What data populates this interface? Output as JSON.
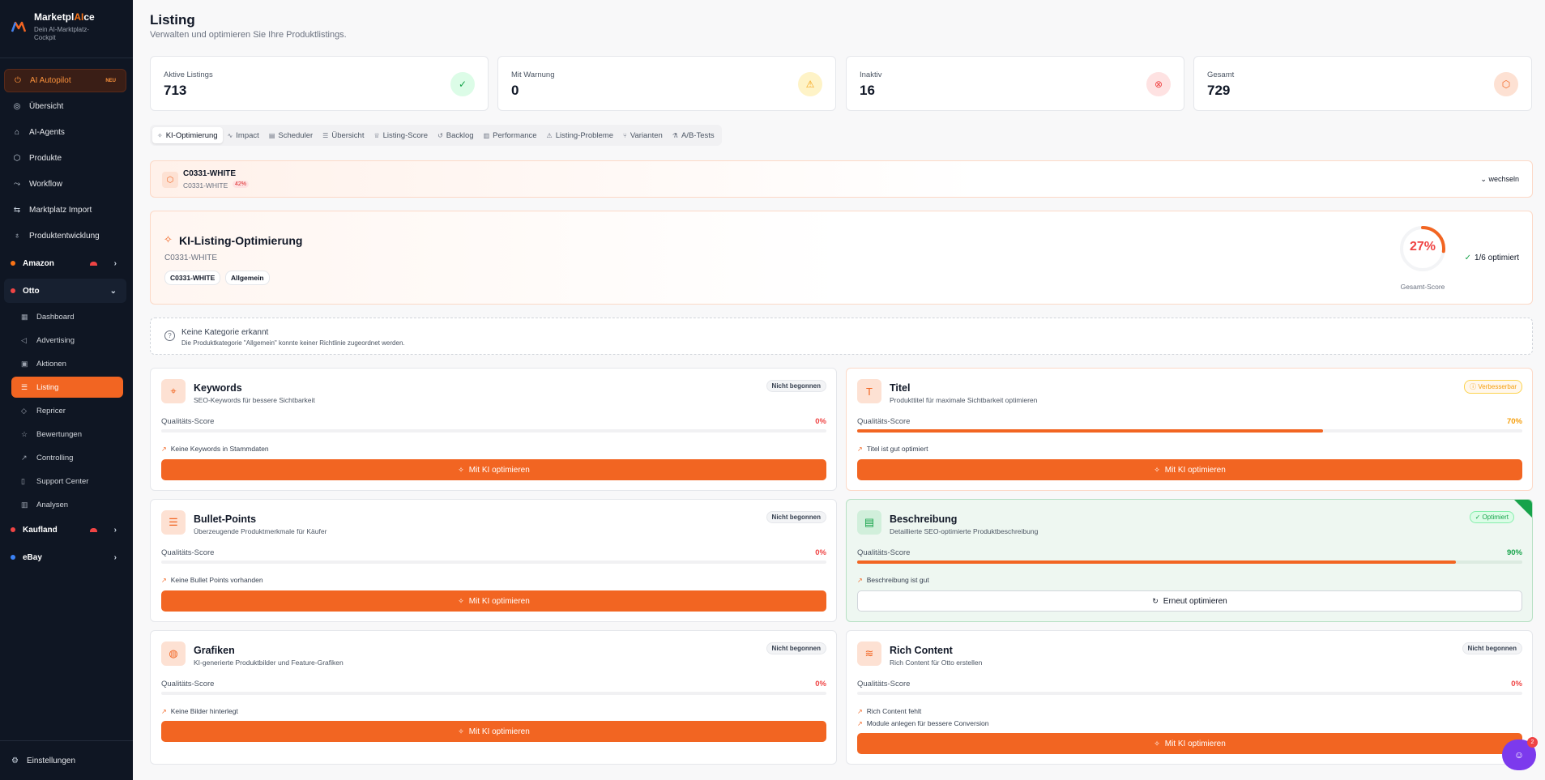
{
  "brand": {
    "name_pre": "Marketpl",
    "name_ai": "AI",
    "name_post": "ce",
    "subtitle": "Dein AI-Marktplatz-Cockpit"
  },
  "nav": {
    "autopilot": {
      "label": "AI Autopilot",
      "badge": "NEU",
      "icon": "autopilot-icon"
    },
    "items": [
      {
        "label": "Übersicht",
        "icon": "globe-icon"
      },
      {
        "label": "AI-Agents",
        "icon": "bot-icon"
      },
      {
        "label": "Produkte",
        "icon": "box-icon"
      },
      {
        "label": "Workflow",
        "icon": "workflow-icon"
      },
      {
        "label": "Marktplatz Import",
        "icon": "arrows-icon"
      },
      {
        "label": "Produktentwicklung",
        "icon": "lightbulb-icon"
      }
    ],
    "marketplaces": [
      {
        "label": "Amazon",
        "color": "#f97316"
      },
      {
        "label": "Otto",
        "color": "#ef4444"
      },
      {
        "label": "Kaufland",
        "color": "#ef4444"
      },
      {
        "label": "eBay",
        "color": "#3b82f6"
      }
    ],
    "otto_items": [
      "Dashboard",
      "Advertising",
      "Aktionen",
      "Listing",
      "Repricer",
      "Bewertungen",
      "Controlling",
      "Support Center",
      "Analysen"
    ],
    "settings": "Einstellungen"
  },
  "page": {
    "title": "Listing",
    "subtitle": "Verwalten und optimieren Sie Ihre Produktlistings."
  },
  "stats": [
    {
      "label": "Aktive Listings",
      "value": "713",
      "icon": "check-circle-icon",
      "color": "#16a34a",
      "bg": "#dcfce7"
    },
    {
      "label": "Mit Warnung",
      "value": "0",
      "icon": "warning-icon",
      "color": "#f59e0b",
      "bg": "#fef3c7"
    },
    {
      "label": "Inaktiv",
      "value": "16",
      "icon": "x-circle-icon",
      "color": "#ef4444",
      "bg": "#fee2e2"
    },
    {
      "label": "Gesamt",
      "value": "729",
      "icon": "package-icon",
      "color": "#f26522",
      "bg": "#fde1d3"
    }
  ],
  "tabs": [
    "KI-Optimierung",
    "Impact",
    "Scheduler",
    "Übersicht",
    "Listing-Score",
    "Backlog",
    "Performance",
    "Listing-Probleme",
    "Varianten",
    "A/B-Tests"
  ],
  "product": {
    "title": "C0331-WHITE",
    "sku": "C0331-WHITE",
    "score_badge": "42%",
    "switch": "wechseln"
  },
  "optimization": {
    "title": "KI-Listing-Optimierung",
    "sku": "C0331-WHITE",
    "chips": [
      "C0331-WHITE",
      "Allgemein"
    ],
    "score": "27%",
    "score_fraction": 0.27,
    "score_label": "Gesamt-Score",
    "count": "1/6 optimiert"
  },
  "notice": {
    "title": "Keine Kategorie erkannt",
    "text": "Die Produktkategorie \"Allgemein\" konnte keiner Richtlinie zugeordnet werden."
  },
  "quality_label": "Qualitäts-Score",
  "cards": [
    {
      "title": "Keywords",
      "sub": "SEO-Keywords für bessere Sichtbarkeit",
      "badge": "Nicht begonnen",
      "score": "0%",
      "notes": [
        "Keine Keywords in Stammdaten"
      ],
      "button": "Mit KI optimieren"
    },
    {
      "title": "Titel",
      "sub": "Produkttitel für maximale Sichtbarkeit optimieren",
      "badge": "Verbesserbar",
      "score": "70%",
      "notes": [
        "Titel ist gut optimiert"
      ],
      "button": "Mit KI optimieren"
    },
    {
      "title": "Bullet-Points",
      "sub": "Überzeugende Produktmerkmale für Käufer",
      "badge": "Nicht begonnen",
      "score": "0%",
      "notes": [
        "Keine Bullet Points vorhanden"
      ],
      "button": "Mit KI optimieren"
    },
    {
      "title": "Beschreibung",
      "sub": "Detaillierte SEO-optimierte Produktbeschreibung",
      "badge": "Optimiert",
      "score": "90%",
      "notes": [
        "Beschreibung ist gut"
      ],
      "button": "Erneut optimieren"
    },
    {
      "title": "Grafiken",
      "sub": "KI-generierte Produktbilder und Feature-Grafiken",
      "badge": "Nicht begonnen",
      "score": "0%",
      "notes": [
        "Keine Bilder hinterlegt"
      ],
      "button": "Mit KI optimieren"
    },
    {
      "title": "Rich Content",
      "sub": "Rich Content für Otto erstellen",
      "badge": "Nicht begonnen",
      "score": "0%",
      "notes": [
        "Rich Content fehlt",
        "Module anlegen für bessere Conversion"
      ],
      "button": "Mit KI optimieren"
    }
  ],
  "chat": {
    "badge": "2"
  }
}
